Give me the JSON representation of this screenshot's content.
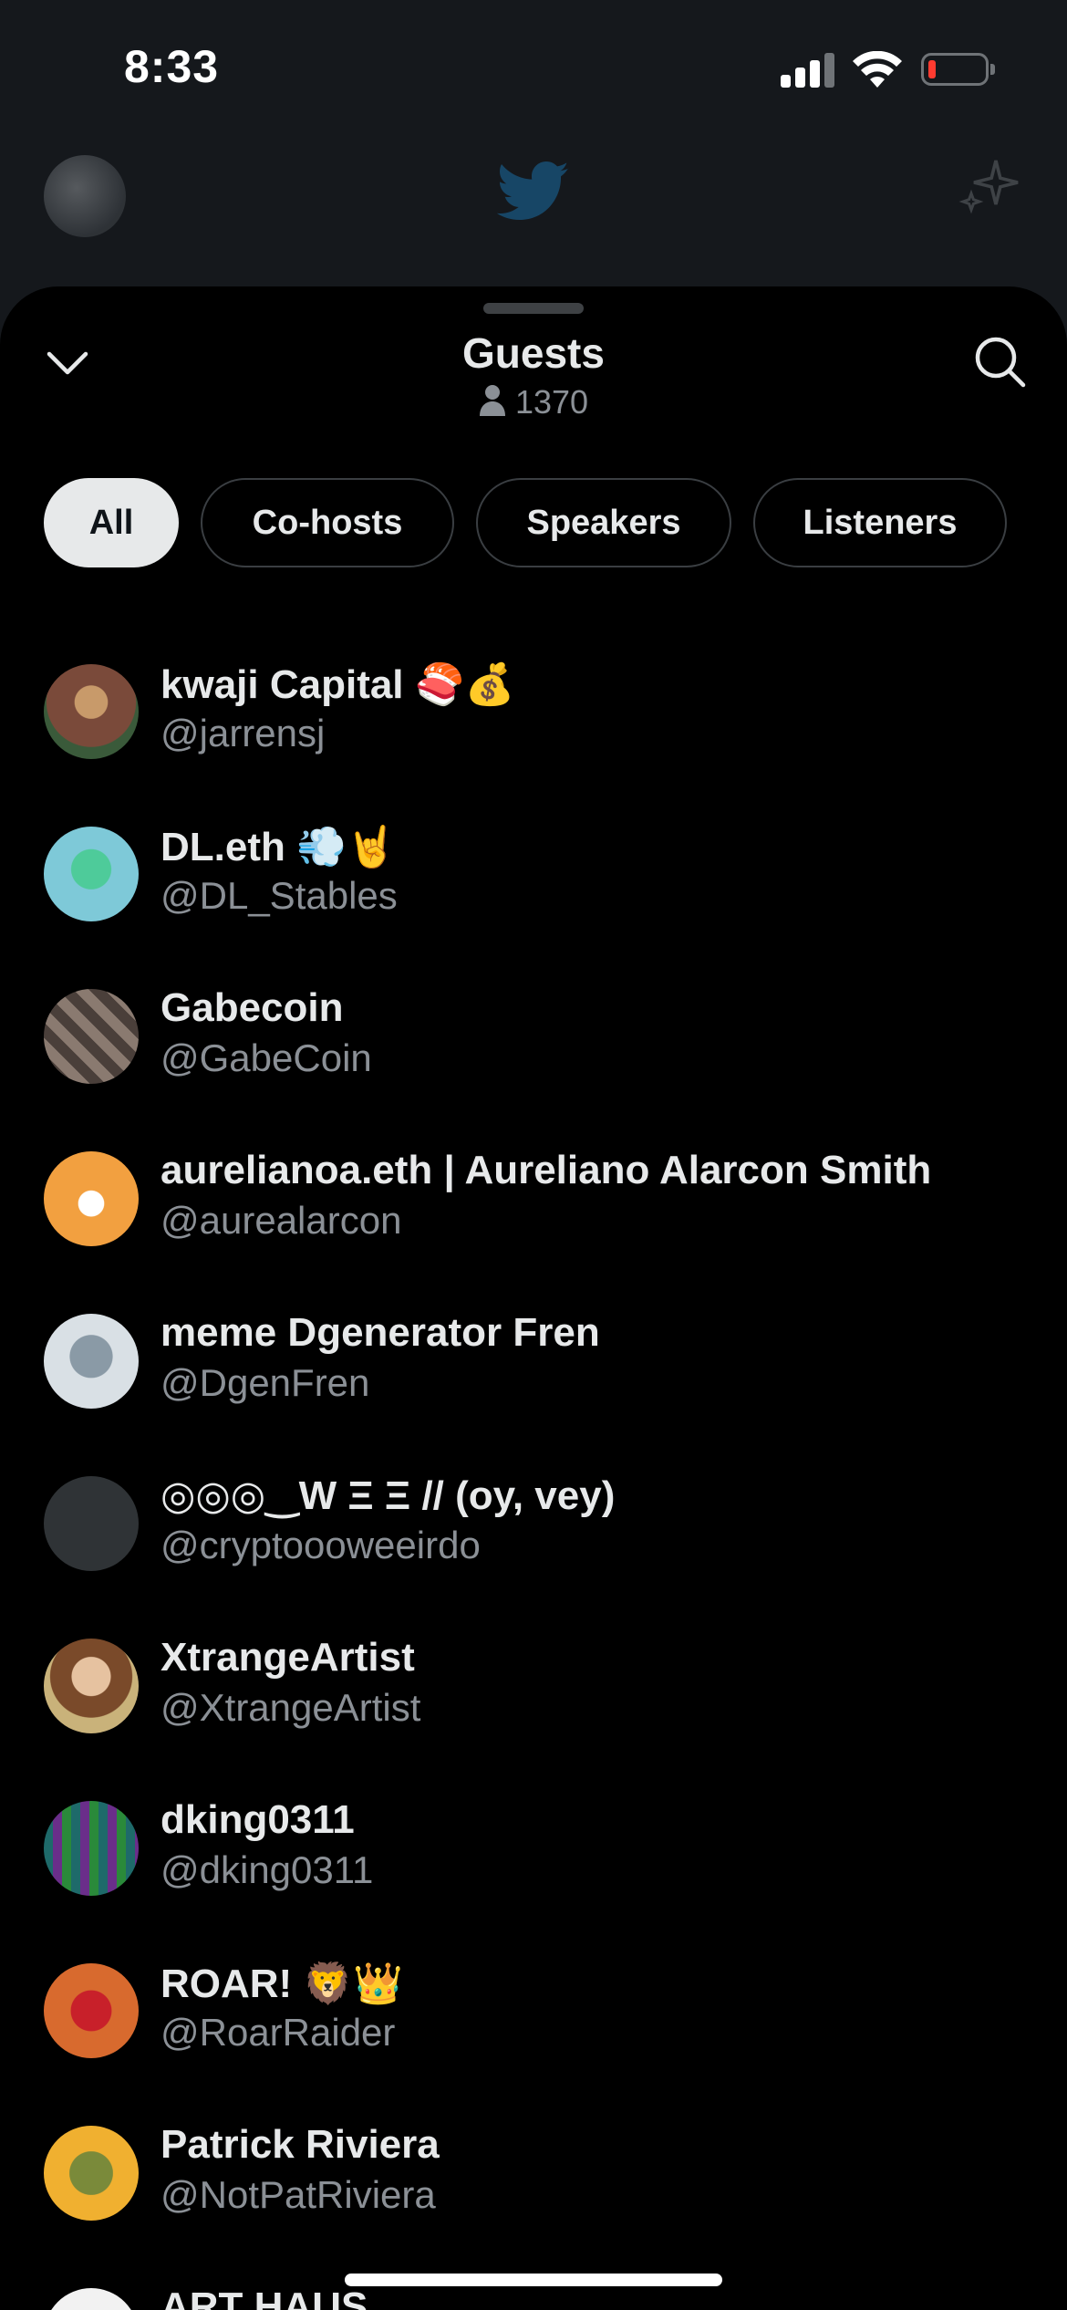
{
  "status_bar": {
    "time": "8:33"
  },
  "sheet": {
    "title": "Guests",
    "listener_count": "1370"
  },
  "filters": [
    {
      "label": "All",
      "active": true
    },
    {
      "label": "Co-hosts",
      "active": false
    },
    {
      "label": "Speakers",
      "active": false
    },
    {
      "label": "Listeners",
      "active": false
    }
  ],
  "guests": [
    {
      "name": "kwaji Capital 🍣💰",
      "handle": "@jarrensj",
      "avatar_color": "#7a4a3a"
    },
    {
      "name": "DL.eth 💨🤘",
      "handle": "@DL_Stables",
      "avatar_color": "#7ec9d8"
    },
    {
      "name": "Gabecoin",
      "handle": "@GabeCoin",
      "avatar_color": "#6b5a52"
    },
    {
      "name": "aurelianoa.eth | Aureliano Alarcon Smith",
      "handle": "@aurealarcon",
      "avatar_color": "#f2a040"
    },
    {
      "name": "meme Dgenerator Fren",
      "handle": "@DgenFren",
      "avatar_color": "#b9c3cc"
    },
    {
      "name": "◎◎◎‿W Ξ Ξ // (oy, vey)",
      "handle": "@cryptoooweeirdo",
      "avatar_color": "#2f3336"
    },
    {
      "name": "XtrangeArtist",
      "handle": "@XtrangeArtist",
      "avatar_color": "#a06a3e"
    },
    {
      "name": "dking0311",
      "handle": "@dking0311",
      "avatar_color": "#2a4a4a"
    },
    {
      "name": "ROAR! 🦁👑",
      "handle": "@RoarRaider",
      "avatar_color": "#d86a2e"
    },
    {
      "name": "Patrick Riviera",
      "handle": "@NotPatRiviera",
      "avatar_color": "#f0b030"
    },
    {
      "name": "ART HAUS",
      "handle": "",
      "avatar_color": "#f2f2f2"
    }
  ]
}
